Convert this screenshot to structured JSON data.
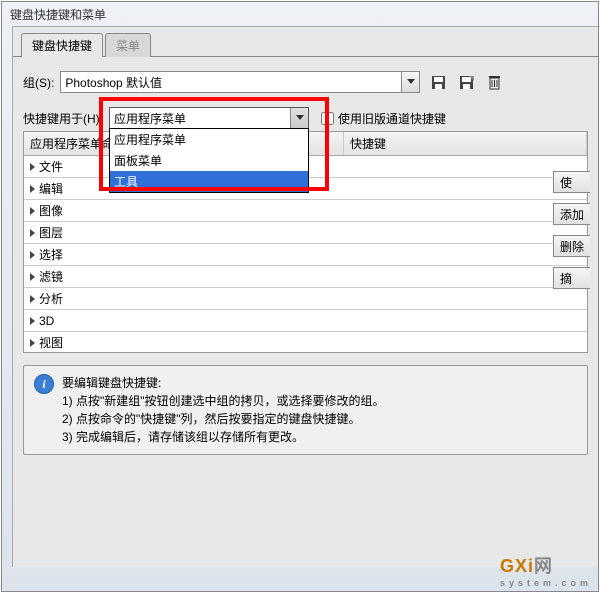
{
  "window_title": "键盘快捷键和菜单",
  "tabs": {
    "shortcuts": "键盘快捷键",
    "menus": "菜单"
  },
  "set_label": "组(S):",
  "set_value": "Photoshop 默认值",
  "shortcuts_for_label": "快捷键用于(H):",
  "shortcuts_for_value": "应用程序菜单",
  "dropdown_options": [
    "应用程序菜单",
    "面板菜单",
    "工具"
  ],
  "use_legacy_label": "使用旧版通道快捷键",
  "table": {
    "col1": "应用程序菜单命令",
    "col2": "快捷键",
    "rows": [
      "文件",
      "编辑",
      "图像",
      "图层",
      "选择",
      "滤镜",
      "分析",
      "3D",
      "视图"
    ]
  },
  "side_buttons": {
    "use": "使",
    "add": "添加",
    "delete": "删除",
    "summary": "摘"
  },
  "info": {
    "title": "要编辑键盘快捷键:",
    "line1": "1) 点按\"新建组\"按钮创建选中组的拷贝，或选择要修改的组。",
    "line2": "2) 点按命令的\"快捷键\"列，然后按要指定的键盘快捷键。",
    "line3": "3) 完成编辑后，请存储该组以存储所有更改。"
  },
  "watermark": {
    "main": "GXi",
    "suffix": "网",
    "sub": "system.com"
  }
}
